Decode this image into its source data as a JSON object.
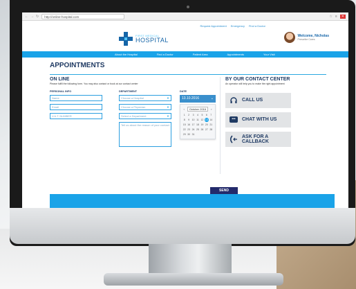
{
  "browser": {
    "url": "http://online-hospital.com",
    "nav_icons": [
      "back-icon",
      "forward-icon",
      "reload-icon"
    ],
    "right_icons": [
      "star-icon",
      "menu-icon",
      "close-icon"
    ]
  },
  "topline": {
    "links": [
      "Request Appointment",
      "Emergency",
      "Find a Doctor"
    ]
  },
  "header": {
    "logo_sub": "FIRST MEDICAL",
    "logo_main": "HOSPITAL",
    "user_name": "Welcome, Nicholas",
    "user_sub": "Prescribe Cares"
  },
  "nav": [
    "About the Hospital",
    "Find a Doctor",
    "Patient Area",
    "Appointments",
    "Your Visit"
  ],
  "page": {
    "title": "APPOINTMENTS",
    "online_title": "ON LINE",
    "online_note": "Please fulfill the following form. You may also contact or book at our contact center",
    "contact_title": "BY OUR CONTACT CENTER",
    "contact_note": "An operator will help you to make the right appointment"
  },
  "form": {
    "personal_label": "PERSONAL INFO",
    "personal_fields": [
      "Name",
      "Email",
      "V.A.T. NUMBER"
    ],
    "department_label": "DEPARTMENT",
    "department_fields": [
      "Choose a Hospital",
      "Choose a Physician",
      "Select a Department"
    ],
    "message_placeholder": "Tell us about the reason of your contact",
    "date_label": "DATE",
    "date_value": "13.10.2016",
    "calendar_month": "October 2016",
    "calendar_days": [
      "1",
      "2",
      "3",
      "4",
      "5",
      "6",
      "7",
      "8",
      "9",
      "10",
      "11",
      "12",
      "13",
      "14",
      "15",
      "16",
      "17",
      "18",
      "19",
      "20",
      "21",
      "22",
      "23",
      "24",
      "25",
      "26",
      "27",
      "28",
      "29",
      "30",
      "31"
    ],
    "selected_day": "13",
    "send_label": "SEND"
  },
  "contact": {
    "call_label": "CALL US",
    "chat_label": "CHAT WITH US",
    "callback_label": "ASK FOR A CALLBACK"
  },
  "colors": {
    "accent": "#1aa3e8",
    "navy": "#1f3a63",
    "send": "#232a6b"
  }
}
